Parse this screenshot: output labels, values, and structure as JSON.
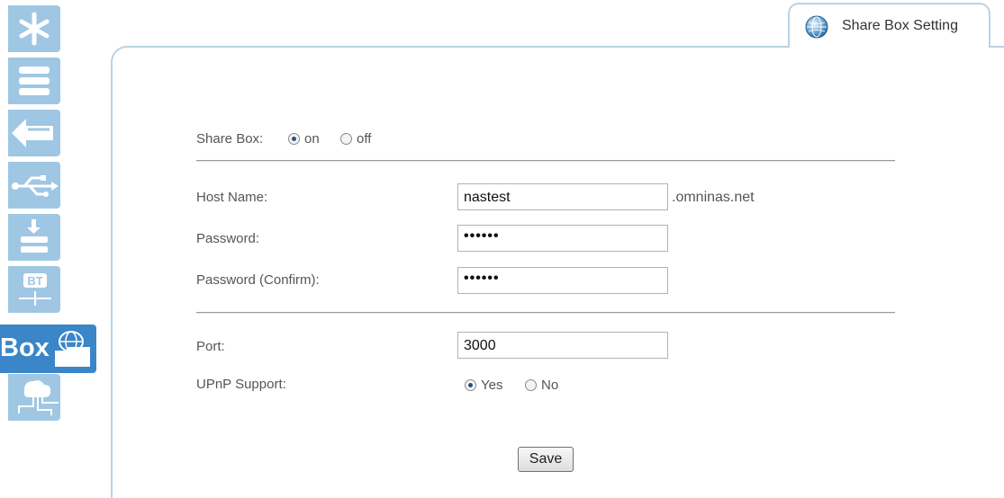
{
  "tab": {
    "title": "Share Box Setting",
    "icon": "globe-icon"
  },
  "sidebar": {
    "items": [
      {
        "icon": "tools-icon"
      },
      {
        "icon": "storage-icon"
      },
      {
        "icon": "transfer-icon"
      },
      {
        "icon": "usb-icon"
      },
      {
        "icon": "download-icon"
      },
      {
        "icon": "bt-download-icon"
      },
      {
        "icon": "share-box-icon",
        "label": "Box",
        "active": true
      },
      {
        "icon": "network-icon"
      }
    ],
    "bt_text": "BT"
  },
  "form": {
    "share_box": {
      "label": "Share Box:",
      "options": [
        {
          "label": "on",
          "checked": true
        },
        {
          "label": "off",
          "checked": false
        }
      ]
    },
    "host_name": {
      "label": "Host Name:",
      "value": "nastest",
      "suffix": ".omninas.net"
    },
    "password": {
      "label": "Password:",
      "value": "••••••"
    },
    "password_confirm": {
      "label": "Password (Confirm):",
      "value": "••••••"
    },
    "port": {
      "label": "Port:",
      "value": "3000"
    },
    "upnp": {
      "label": "UPnP Support:",
      "options": [
        {
          "label": "Yes",
          "checked": true
        },
        {
          "label": "No",
          "checked": false
        }
      ]
    },
    "save_label": "Save"
  },
  "colors": {
    "rail": "#9fc7e3",
    "rail_active": "#3a86c8",
    "frame": "#b9d3e6"
  }
}
